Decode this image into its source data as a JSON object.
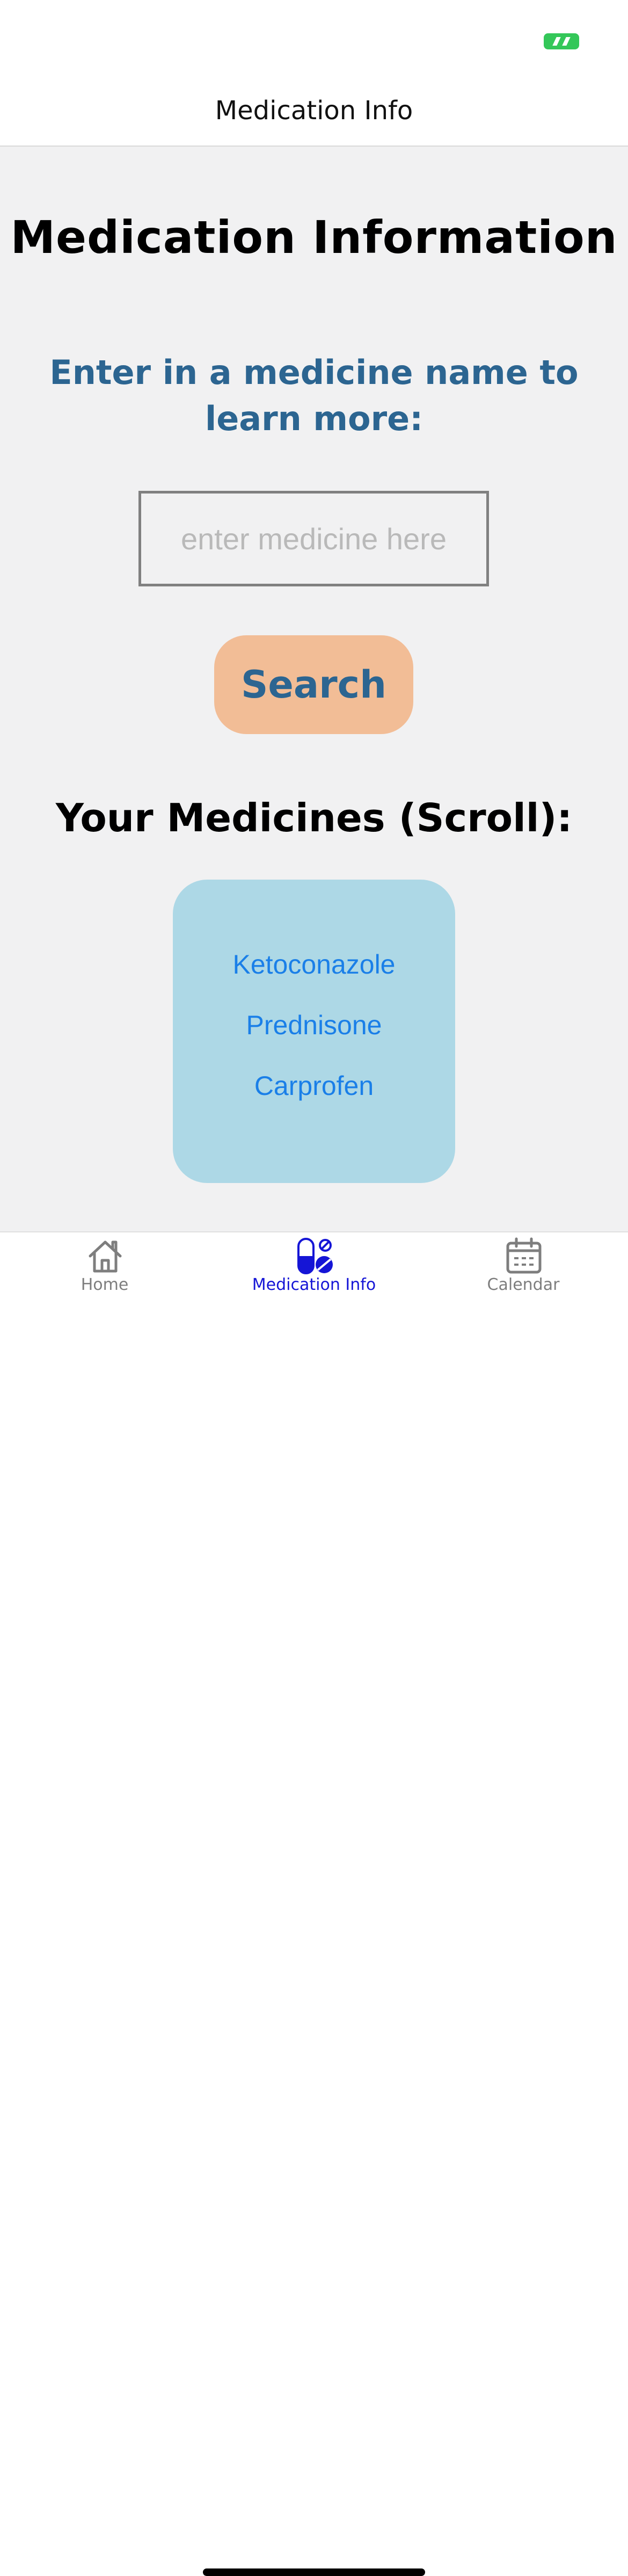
{
  "nav": {
    "title": "Medication Info"
  },
  "main": {
    "title": "Medication Information",
    "instructions": "Enter in a medicine name to learn more:",
    "search": {
      "placeholder": "enter medicine here",
      "value": "",
      "button_label": "Search"
    },
    "medicines_heading": "Your Medicines (Scroll):",
    "medicines": [
      "Ketoconazole",
      "Prednisone",
      "Carprofen"
    ]
  },
  "tabs": [
    {
      "label": "Home",
      "icon": "home-icon",
      "active": false
    },
    {
      "label": "Medication Info",
      "icon": "pills-icon",
      "active": true
    },
    {
      "label": "Calendar",
      "icon": "calendar-icon",
      "active": false
    }
  ],
  "colors": {
    "accent_blue": "#2c6591",
    "button_peach": "#f2bd96",
    "list_background": "#add8e6",
    "list_link": "#1a7fe8",
    "active_tab": "#1515d6",
    "battery_green": "#34c759"
  }
}
